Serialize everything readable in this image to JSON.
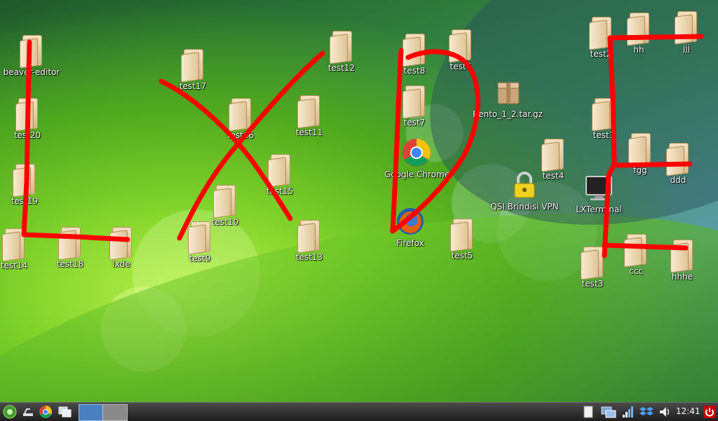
{
  "desktop": {
    "icons": [
      {
        "label": "beaver-editor",
        "kind": "folder"
      },
      {
        "label": "test20",
        "kind": "folder"
      },
      {
        "label": "test19",
        "kind": "folder"
      },
      {
        "label": "test14",
        "kind": "folder"
      },
      {
        "label": "test18",
        "kind": "folder"
      },
      {
        "label": "lxde",
        "kind": "folder"
      },
      {
        "label": "test17",
        "kind": "folder"
      },
      {
        "label": "test16",
        "kind": "folder"
      },
      {
        "label": "test15",
        "kind": "folder"
      },
      {
        "label": "test10",
        "kind": "folder"
      },
      {
        "label": "test9",
        "kind": "folder"
      },
      {
        "label": "test12",
        "kind": "folder"
      },
      {
        "label": "test11",
        "kind": "folder"
      },
      {
        "label": "test13",
        "kind": "folder"
      },
      {
        "label": "test8",
        "kind": "folder"
      },
      {
        "label": "test6",
        "kind": "folder"
      },
      {
        "label": "test7",
        "kind": "folder"
      },
      {
        "label": "Google Chrome",
        "kind": "chrome"
      },
      {
        "label": "Firefox",
        "kind": "firefox"
      },
      {
        "label": "test5",
        "kind": "folder"
      },
      {
        "label": "Bento_1_2.tar.gz",
        "kind": "archive"
      },
      {
        "label": "test4",
        "kind": "folder"
      },
      {
        "label": "QSI Brindisi VPN",
        "kind": "lock"
      },
      {
        "label": "test2",
        "kind": "folder"
      },
      {
        "label": "hh",
        "kind": "folder"
      },
      {
        "label": "jjj",
        "kind": "folder"
      },
      {
        "label": "test1",
        "kind": "folder"
      },
      {
        "label": "fgg",
        "kind": "folder"
      },
      {
        "label": "ddd",
        "kind": "folder"
      },
      {
        "label": "LXTerminal",
        "kind": "terminal"
      },
      {
        "label": "test3",
        "kind": "folder"
      },
      {
        "label": "ccc",
        "kind": "folder"
      },
      {
        "label": "hhhe",
        "kind": "folder"
      }
    ]
  },
  "panel": {
    "clock": "12:41",
    "launchers": [
      "menu-icon",
      "show-desktop-icon",
      "chrome-icon",
      "windows-icon"
    ],
    "tray": [
      "clipboard-icon",
      "network-icon",
      "signal-icon",
      "dropbox-icon",
      "volume-icon"
    ],
    "accent": "#c40000"
  }
}
